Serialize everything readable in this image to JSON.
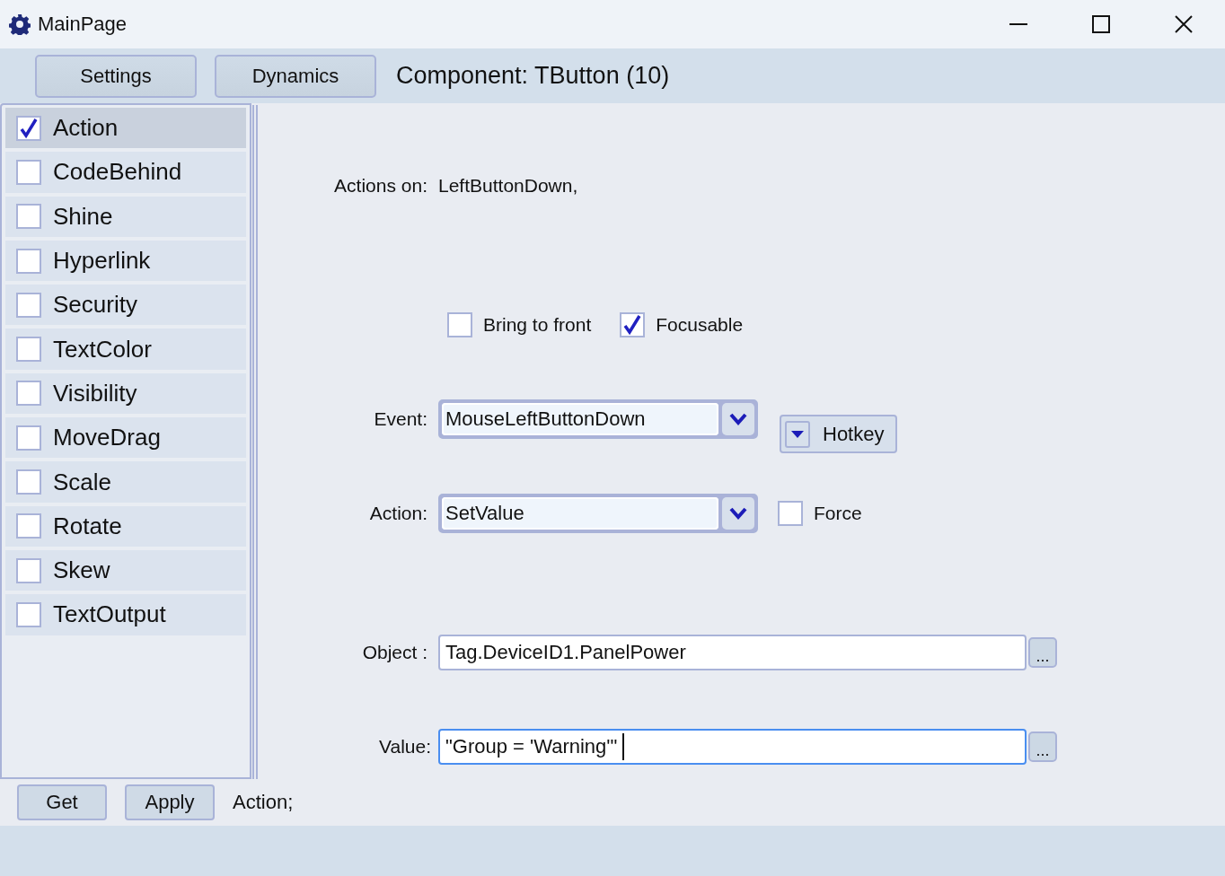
{
  "window": {
    "title": "MainPage"
  },
  "toolbar": {
    "buttons": [
      "Settings",
      "Dynamics"
    ],
    "component": "Component: TButton (10)"
  },
  "dynamics": [
    {
      "label": "Action",
      "checked": true,
      "selected": true
    },
    {
      "label": "CodeBehind",
      "checked": false,
      "selected": false
    },
    {
      "label": "Shine",
      "checked": false,
      "selected": false
    },
    {
      "label": "Hyperlink",
      "checked": false,
      "selected": false
    },
    {
      "label": "Security",
      "checked": false,
      "selected": false
    },
    {
      "label": "TextColor",
      "checked": false,
      "selected": false
    },
    {
      "label": "Visibility",
      "checked": false,
      "selected": false
    },
    {
      "label": "MoveDrag",
      "checked": false,
      "selected": false
    },
    {
      "label": "Scale",
      "checked": false,
      "selected": false
    },
    {
      "label": "Rotate",
      "checked": false,
      "selected": false
    },
    {
      "label": "Skew",
      "checked": false,
      "selected": false
    },
    {
      "label": "TextOutput",
      "checked": false,
      "selected": false
    }
  ],
  "form": {
    "actions_on_label": "Actions on:",
    "actions_on_value": "LeftButtonDown,",
    "options": [
      {
        "label": "Bring to front",
        "checked": false
      },
      {
        "label": "Focusable",
        "checked": true
      }
    ],
    "event": {
      "label": "Event:",
      "value": "MouseLeftButtonDown"
    },
    "hotkey": "Hotkey",
    "action": {
      "label": "Action:",
      "value": "SetValue"
    },
    "force": {
      "label": "Force",
      "checked": false
    },
    "object": {
      "label": "Object :",
      "value": "Tag.DeviceID1.PanelPower",
      "browse": "..."
    },
    "value": {
      "label": "Value:",
      "value": "\"Group = 'Warning'\"",
      "browse": "...",
      "focused": true
    }
  },
  "bottom": {
    "buttons": [
      "Get",
      "Apply"
    ],
    "status": "Action;"
  }
}
